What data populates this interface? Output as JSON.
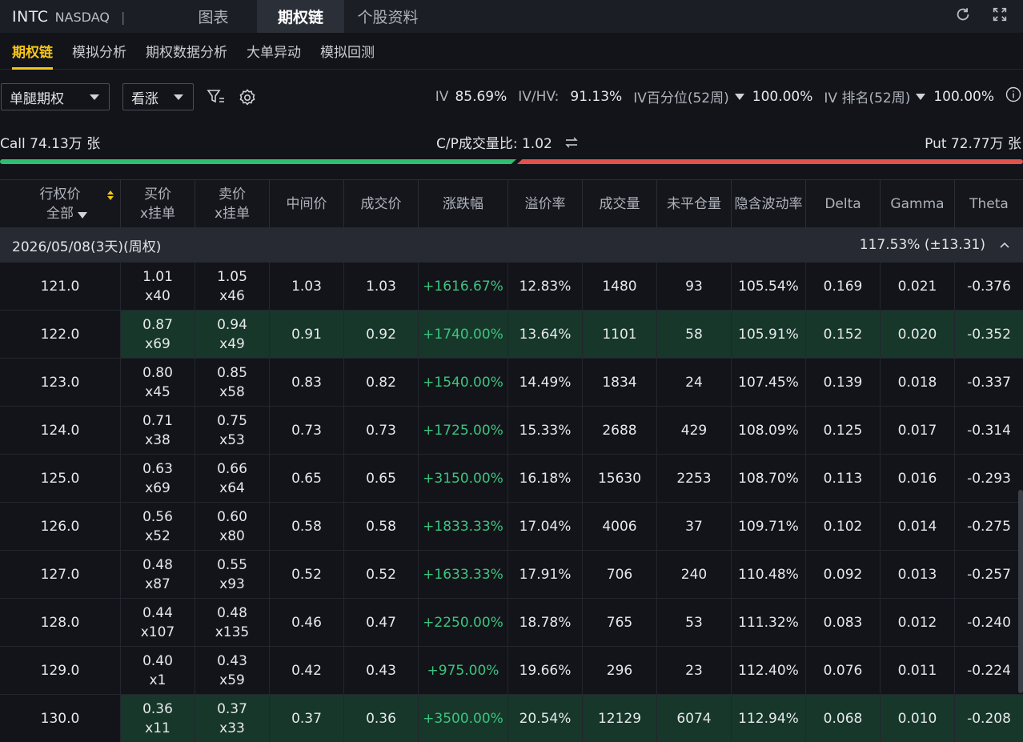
{
  "topbar": {
    "symbol": "INTC",
    "exchange": "NASDAQ",
    "separator": "|",
    "tabs": [
      {
        "label": "图表",
        "active": false
      },
      {
        "label": "期权链",
        "active": true
      },
      {
        "label": "个股资料",
        "active": false
      }
    ],
    "icons": [
      "refresh-icon",
      "fullscreen-icon"
    ]
  },
  "subtabs": [
    {
      "label": "期权链",
      "active": true
    },
    {
      "label": "模拟分析",
      "active": false
    },
    {
      "label": "期权数据分析",
      "active": false
    },
    {
      "label": "大单异动",
      "active": false
    },
    {
      "label": "模拟回测",
      "active": false
    }
  ],
  "filters": {
    "strategy": "单腿期权",
    "direction": "看涨",
    "iv_label": "IV",
    "iv_value": "85.69%",
    "ivhv_label": "IV/HV:",
    "ivhv_value": "91.13%",
    "ivpct_label": "IV百分位(52周)",
    "ivpct_value": "100.00%",
    "ivrank_label": "IV 排名(52周)",
    "ivrank_value": "100.00%"
  },
  "volume": {
    "call": "Call 74.13万 张",
    "ratio": "C/P成交量比:  1.02",
    "put": "Put 72.77万 张",
    "call_share": 0.505
  },
  "colors": {
    "accent": "#f5c518",
    "up": "#3cc47f",
    "call_bar": "#2fbf71",
    "put_bar": "#e2514c",
    "highlight": "#16372a"
  },
  "table": {
    "headers": [
      {
        "l1": "行权价",
        "l2": "全部"
      },
      {
        "l1": "买价",
        "l2": "x挂单"
      },
      {
        "l1": "卖价",
        "l2": "x挂单"
      },
      {
        "l1": "中间价",
        "l2": ""
      },
      {
        "l1": "成交价",
        "l2": ""
      },
      {
        "l1": "涨跌幅",
        "l2": ""
      },
      {
        "l1": "溢价率",
        "l2": ""
      },
      {
        "l1": "成交量",
        "l2": ""
      },
      {
        "l1": "未平仓量",
        "l2": ""
      },
      {
        "l1": "隐含波动率",
        "l2": ""
      },
      {
        "l1": "Delta",
        "l2": ""
      },
      {
        "l1": "Gamma",
        "l2": ""
      },
      {
        "l1": "Theta",
        "l2": ""
      }
    ],
    "group": {
      "date": "2026/05/08(3天)(周权)",
      "move": "117.53% (±13.31)"
    },
    "rows": [
      {
        "strike": "121.0",
        "bid": "1.01",
        "bidsz": "x40",
        "ask": "1.05",
        "asksz": "x46",
        "mid": "1.03",
        "last": "1.03",
        "chg": "+1616.67%",
        "prem": "12.83%",
        "vol": "1480",
        "oi": "93",
        "iv": "105.54%",
        "delta": "0.169",
        "gamma": "0.021",
        "theta": "-0.376",
        "hl": false
      },
      {
        "strike": "122.0",
        "bid": "0.87",
        "bidsz": "x69",
        "ask": "0.94",
        "asksz": "x49",
        "mid": "0.91",
        "last": "0.92",
        "chg": "+1740.00%",
        "prem": "13.64%",
        "vol": "1101",
        "oi": "58",
        "iv": "105.91%",
        "delta": "0.152",
        "gamma": "0.020",
        "theta": "-0.352",
        "hl": true
      },
      {
        "strike": "123.0",
        "bid": "0.80",
        "bidsz": "x45",
        "ask": "0.85",
        "asksz": "x58",
        "mid": "0.83",
        "last": "0.82",
        "chg": "+1540.00%",
        "prem": "14.49%",
        "vol": "1834",
        "oi": "24",
        "iv": "107.45%",
        "delta": "0.139",
        "gamma": "0.018",
        "theta": "-0.337",
        "hl": false
      },
      {
        "strike": "124.0",
        "bid": "0.71",
        "bidsz": "x38",
        "ask": "0.75",
        "asksz": "x53",
        "mid": "0.73",
        "last": "0.73",
        "chg": "+1725.00%",
        "prem": "15.33%",
        "vol": "2688",
        "oi": "429",
        "iv": "108.09%",
        "delta": "0.125",
        "gamma": "0.017",
        "theta": "-0.314",
        "hl": false
      },
      {
        "strike": "125.0",
        "bid": "0.63",
        "bidsz": "x69",
        "ask": "0.66",
        "asksz": "x64",
        "mid": "0.65",
        "last": "0.65",
        "chg": "+3150.00%",
        "prem": "16.18%",
        "vol": "15630",
        "oi": "2253",
        "iv": "108.70%",
        "delta": "0.113",
        "gamma": "0.016",
        "theta": "-0.293",
        "hl": false
      },
      {
        "strike": "126.0",
        "bid": "0.56",
        "bidsz": "x52",
        "ask": "0.60",
        "asksz": "x80",
        "mid": "0.58",
        "last": "0.58",
        "chg": "+1833.33%",
        "prem": "17.04%",
        "vol": "4006",
        "oi": "37",
        "iv": "109.71%",
        "delta": "0.102",
        "gamma": "0.014",
        "theta": "-0.275",
        "hl": false
      },
      {
        "strike": "127.0",
        "bid": "0.48",
        "bidsz": "x87",
        "ask": "0.55",
        "asksz": "x93",
        "mid": "0.52",
        "last": "0.52",
        "chg": "+1633.33%",
        "prem": "17.91%",
        "vol": "706",
        "oi": "240",
        "iv": "110.48%",
        "delta": "0.092",
        "gamma": "0.013",
        "theta": "-0.257",
        "hl": false
      },
      {
        "strike": "128.0",
        "bid": "0.44",
        "bidsz": "x107",
        "ask": "0.48",
        "asksz": "x135",
        "mid": "0.46",
        "last": "0.47",
        "chg": "+2250.00%",
        "prem": "18.78%",
        "vol": "765",
        "oi": "53",
        "iv": "111.32%",
        "delta": "0.083",
        "gamma": "0.012",
        "theta": "-0.240",
        "hl": false
      },
      {
        "strike": "129.0",
        "bid": "0.40",
        "bidsz": "x1",
        "ask": "0.43",
        "asksz": "x59",
        "mid": "0.42",
        "last": "0.43",
        "chg": "+975.00%",
        "prem": "19.66%",
        "vol": "296",
        "oi": "23",
        "iv": "112.40%",
        "delta": "0.076",
        "gamma": "0.011",
        "theta": "-0.224",
        "hl": false
      },
      {
        "strike": "130.0",
        "bid": "0.36",
        "bidsz": "x11",
        "ask": "0.37",
        "asksz": "x33",
        "mid": "0.37",
        "last": "0.36",
        "chg": "+3500.00%",
        "prem": "20.54%",
        "vol": "12129",
        "oi": "6074",
        "iv": "112.94%",
        "delta": "0.068",
        "gamma": "0.010",
        "theta": "-0.208",
        "hl": true
      }
    ]
  }
}
